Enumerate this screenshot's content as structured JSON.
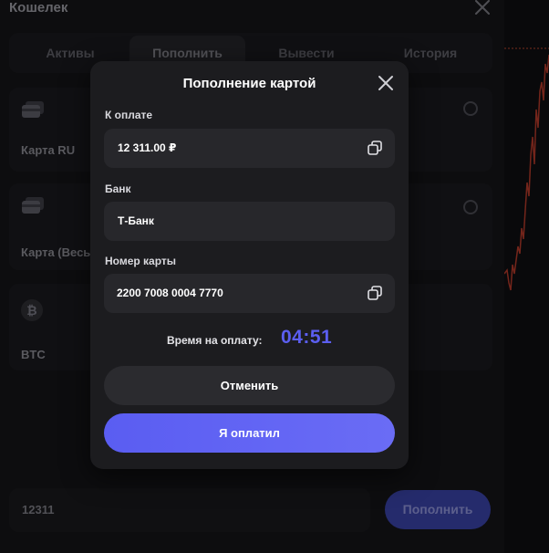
{
  "wallet": {
    "title": "Кошелек",
    "tabs": [
      {
        "label": "Активы"
      },
      {
        "label": "Пополнить"
      },
      {
        "label": "Вывести"
      },
      {
        "label": "История"
      }
    ],
    "methods": [
      {
        "label": "Карта RU",
        "icon": "card-icon"
      },
      {
        "label": "Карта (Весь",
        "icon": "card-icon"
      },
      {
        "label": "BTC",
        "icon": "bitcoin-icon"
      }
    ],
    "amount_value": "12311",
    "deposit_label": "Пополнить"
  },
  "modal": {
    "title": "Пополнение картой",
    "amount_label": "К оплате",
    "amount_value": "12 311.00 ₽",
    "bank_label": "Банк",
    "bank_value": "Т-Банк",
    "card_label": "Номер карты",
    "card_value": "2200 7008 0004 7770",
    "timer_label": "Время на оплату:",
    "timer_value": "04:51",
    "cancel_label": "Отменить",
    "paid_label": "Я оплатил"
  },
  "colors": {
    "accent": "#5b5ef0",
    "chart_line": "#c0392b"
  }
}
